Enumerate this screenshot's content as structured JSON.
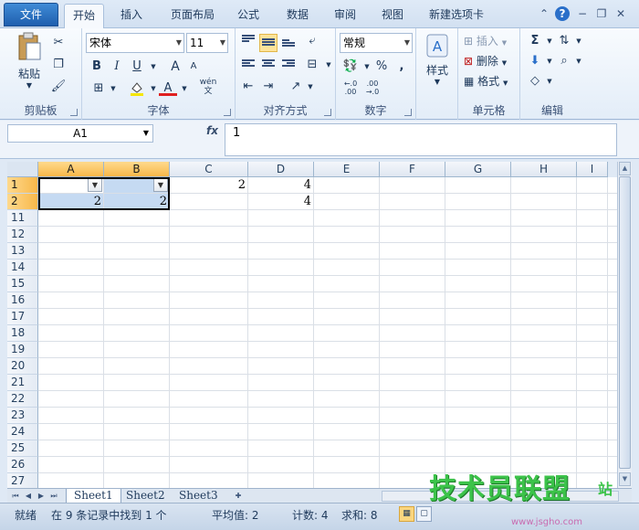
{
  "tabs": [
    {
      "label": "文件",
      "active": false
    },
    {
      "label": "开始",
      "active": true
    },
    {
      "label": "插入",
      "active": false
    },
    {
      "label": "页面布局",
      "active": false
    },
    {
      "label": "公式",
      "active": false
    },
    {
      "label": "数据",
      "active": false
    },
    {
      "label": "审阅",
      "active": false
    },
    {
      "label": "视图",
      "active": false
    },
    {
      "label": "新建选项卡",
      "active": false
    }
  ],
  "window_controls": {
    "help": "?",
    "min": "−",
    "restore": "❐",
    "close": "✕",
    "collapse": "⌃"
  },
  "ribbon": {
    "clipboard": {
      "label": "剪贴板",
      "paste": "粘贴"
    },
    "font": {
      "label": "字体",
      "font_name": "宋体",
      "font_size": "11",
      "bold": "B",
      "italic": "I",
      "underline": "U",
      "grow": "A",
      "shrink": "A",
      "color_a": "A",
      "wen": "wén\n文"
    },
    "align": {
      "label": "对齐方式"
    },
    "number": {
      "label": "数字",
      "format": "常规",
      "percent": "%",
      "comma": ",",
      "inc": "←.0\n.00",
      "dec": ".00\n→.0"
    },
    "styles": {
      "label": "样式",
      "button": "样式"
    },
    "cells": {
      "label": "单元格",
      "insert": "插入",
      "delete": "删除",
      "format": "格式"
    },
    "editing": {
      "label": "编辑",
      "sum": "Σ"
    }
  },
  "formula_bar": {
    "name_box": "A1",
    "fx": "fx",
    "value": "1"
  },
  "columns": [
    "A",
    "B",
    "C",
    "D",
    "E",
    "F",
    "G",
    "H",
    "I"
  ],
  "selected_columns": [
    "A",
    "B"
  ],
  "rows": [
    "1",
    "2",
    "11",
    "12",
    "13",
    "14",
    "15",
    "16",
    "17",
    "18",
    "19",
    "20",
    "21",
    "22",
    "23",
    "24",
    "25",
    "26",
    "27"
  ],
  "selected_rows": [
    "1",
    "2"
  ],
  "cells": {
    "C1": "2",
    "D1": "4",
    "A2": "2",
    "B2": "2",
    "D2": "4"
  },
  "sheet_tabs": [
    {
      "label": "Sheet1",
      "active": true
    },
    {
      "label": "Sheet2",
      "active": false
    },
    {
      "label": "Sheet3",
      "active": false
    }
  ],
  "status": {
    "ready": "就绪",
    "filter_info": "在 9 条记录中找到 1 个",
    "average": "平均值: 2",
    "count": "计数: 4",
    "sum": "求和: 8"
  },
  "watermark": {
    "logo": "技术员联盟",
    "url": "www.jsgho.com",
    "extra": "站"
  },
  "colors": {
    "accent": "#1f5fae",
    "selection": "#c5daf2",
    "header_selected": "#f7b84a",
    "watermark": "#3cc34a"
  }
}
